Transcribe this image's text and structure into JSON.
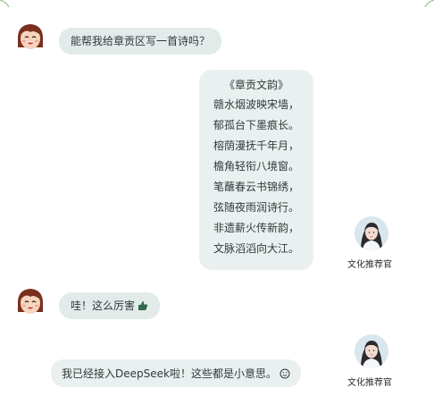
{
  "messages": [
    {
      "role": "user",
      "text": "能帮我给章贡区写一首诗吗？"
    },
    {
      "role": "bot",
      "sender_name": "文化推荐官",
      "poem": {
        "title": "《章贡文韵》",
        "lines": [
          "赣水烟波映宋墙，",
          "郁孤台下墨痕长。",
          "榕荫漫抚千年月，",
          "檐角轻衔八境窗。",
          "笔蘸春云书锦绣，",
          "弦随夜雨润诗行。",
          "非遗薪火传新韵，",
          "文脉滔滔向大江。"
        ]
      }
    },
    {
      "role": "user",
      "text": "哇！这么厉害",
      "trailing_icon": "thumbs-up-icon"
    },
    {
      "role": "bot",
      "sender_name": "文化推荐官",
      "text": "我已经接入DeepSeek啦！这些都是小意思。",
      "trailing_icon": "smile-icon"
    }
  ],
  "colors": {
    "bubble_user": "#e3ebea",
    "bubble_bot": "#eaf0ef",
    "text": "#2f3b3a",
    "corner_leaf": "#9cc38a"
  }
}
